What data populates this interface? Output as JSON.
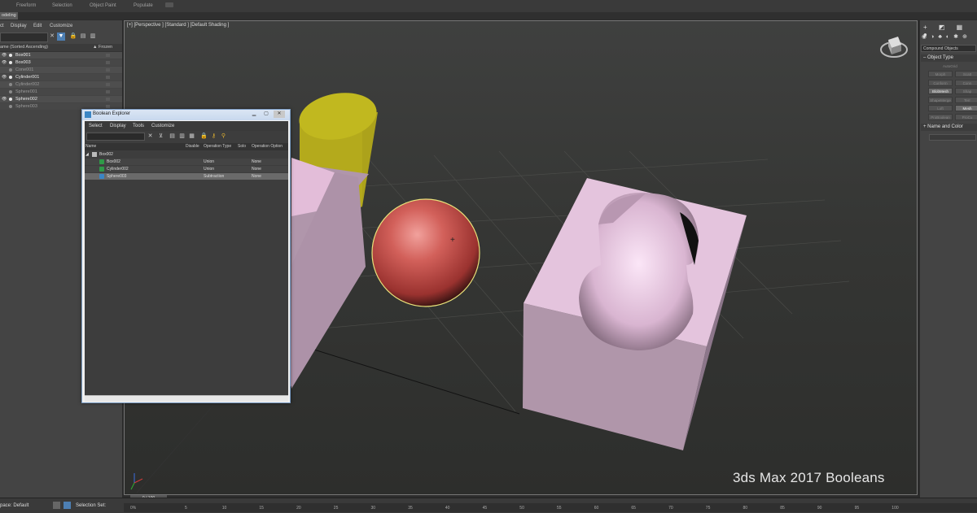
{
  "ribbon": {
    "tabs": [
      "Freeform",
      "Selection",
      "Object Paint",
      "Populate"
    ],
    "active_tab": "odeling"
  },
  "scene_explorer": {
    "menu": [
      "ct",
      "Display",
      "Edit",
      "Customize"
    ],
    "header_name": "ame (Sorted Ascending)",
    "header_frozen": "Frozen",
    "items": [
      {
        "label": "Box001",
        "visible": true,
        "active": true
      },
      {
        "label": "Box003",
        "visible": true,
        "active": true
      },
      {
        "label": "Cone001",
        "visible": false,
        "active": false
      },
      {
        "label": "Cylinder001",
        "visible": true,
        "active": true
      },
      {
        "label": "Cylinder002",
        "visible": false,
        "active": false
      },
      {
        "label": "Sphere001",
        "visible": false,
        "active": false
      },
      {
        "label": "Sphere002",
        "visible": true,
        "active": true
      },
      {
        "label": "Sphere003",
        "visible": false,
        "active": false
      }
    ]
  },
  "viewport": {
    "label": "[+] [Perspective ] [Standard ] [Default Shading ]",
    "caption": "3ds Max 2017 Booleans"
  },
  "boolean_explorer": {
    "title": "Boolean Explorer",
    "menu": [
      "Select",
      "Display",
      "Tools",
      "Customize"
    ],
    "columns": [
      "Name",
      "Disable",
      "Operation Type",
      "Solo",
      "Operation Option"
    ],
    "root": "Box002",
    "operands": [
      {
        "name": "Box002",
        "type": "Union",
        "option": "None"
      },
      {
        "name": "Cylinder002",
        "type": "Union",
        "option": "None"
      },
      {
        "name": "Sphere003",
        "type": "Subtraction",
        "option": "None"
      }
    ]
  },
  "command_panel": {
    "dropdown": "Compound Objects",
    "object_type_label": "Object Type",
    "autogrid_label": "AutoGrid",
    "buttons": [
      {
        "label": "Morph",
        "on": false
      },
      {
        "label": "Scatt",
        "on": false
      },
      {
        "label": "Conform",
        "on": false
      },
      {
        "label": "Conn",
        "on": false
      },
      {
        "label": "BlobMesh",
        "on": true
      },
      {
        "label": "Shap",
        "on": false
      },
      {
        "label": "ShapeMerge",
        "on": false
      },
      {
        "label": "Terr",
        "on": false
      },
      {
        "label": "Loft",
        "on": false
      },
      {
        "label": "Mesh",
        "on": true
      },
      {
        "label": "ProBoolean",
        "on": false
      },
      {
        "label": "ProCu",
        "on": false
      }
    ],
    "name_color_label": "Name and Color"
  },
  "status": {
    "workspace": "pace: Default",
    "selection_sets": "Selection Set:",
    "time": "0 / 100",
    "percent": "0%",
    "ticks": [
      "5",
      "10",
      "15",
      "20",
      "25",
      "30",
      "35",
      "40",
      "45",
      "50",
      "55",
      "60",
      "65",
      "70",
      "75",
      "80",
      "85",
      "90",
      "95",
      "100"
    ]
  },
  "colors": {
    "cylinder": "#b6ad1b",
    "sphere": "#c9514c",
    "box": "#e3b8d9",
    "selection_outline": "#e9e27a",
    "viewport_bg": "#3a3b39"
  }
}
